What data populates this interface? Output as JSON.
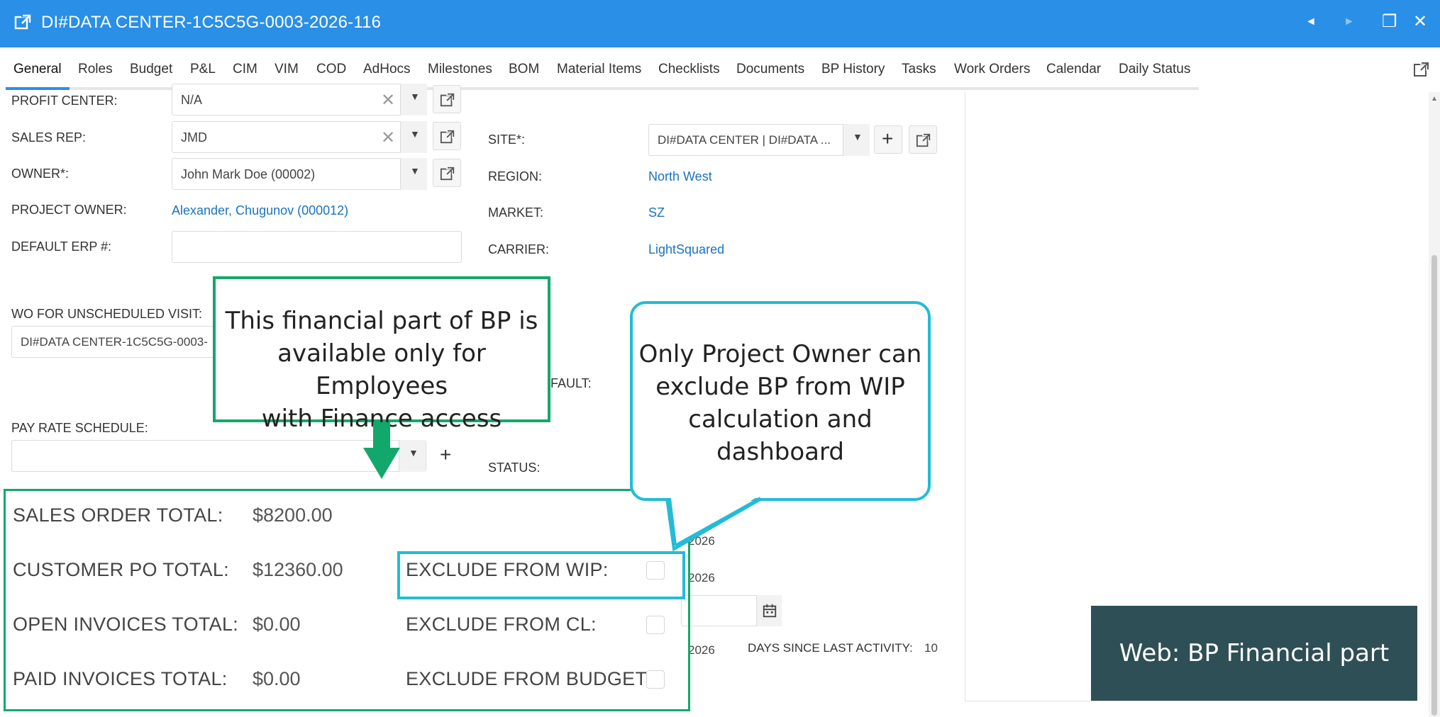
{
  "window": {
    "title": "DI#DATA CENTER-1C5C5G-0003-2026-116",
    "controls": [
      "◄",
      "►",
      "❐",
      "✕"
    ]
  },
  "tabs": [
    "General",
    "Roles",
    "Budget",
    "P&L",
    "CIM",
    "VIM",
    "COD",
    "AdHocs",
    "Milestones",
    "BOM",
    "Material Items",
    "Checklists",
    "Documents",
    "BP History",
    "Tasks",
    "Work Orders",
    "Calendar",
    "Daily Status"
  ],
  "active_tab": "General",
  "left_form": {
    "profit_center": {
      "label": "PROFIT CENTER:",
      "value": "N/A"
    },
    "sales_rep": {
      "label": "SALES REP:",
      "value": "JMD"
    },
    "owner": {
      "label": "OWNER*:",
      "value": "John Mark Doe (00002)"
    },
    "project_owner": {
      "label": "PROJECT OWNER:",
      "value": "Alexander, Chugunov (000012)"
    },
    "default_erp": {
      "label": "DEFAULT ERP #:",
      "value": ""
    },
    "wo_unscheduled": {
      "label": "WO FOR UNSCHEDULED VISIT:",
      "value": "DI#DATA CENTER-1C5C5G-0003-"
    },
    "pay_rate": {
      "label": "PAY RATE SCHEDULE:",
      "value": ""
    }
  },
  "right_form": {
    "site": {
      "label": "SITE*:",
      "value": "DI#DATA CENTER | DI#DATA ..."
    },
    "region": {
      "label": "REGION:",
      "value": "North West"
    },
    "market": {
      "label": "MARKET:",
      "value": "SZ"
    },
    "carrier": {
      "label": "CARRIER:",
      "value": "LightSquared"
    },
    "default_partial": "FAULT:",
    "status": {
      "label": "STATUS:"
    },
    "date1": "2026",
    "date2": "2026",
    "date3": "2026",
    "days_since": {
      "label": "DAYS SINCE LAST ACTIVITY:",
      "value": "10"
    }
  },
  "financial": {
    "sales_order_total": {
      "label": "SALES ORDER TOTAL:",
      "value": "$8200.00"
    },
    "customer_po_total": {
      "label": "CUSTOMER PO TOTAL:",
      "value": "$12360.00"
    },
    "open_invoices_total": {
      "label": "OPEN INVOICES TOTAL:",
      "value": "$0.00"
    },
    "paid_invoices_total": {
      "label": "PAID INVOICES TOTAL:",
      "value": "$0.00"
    },
    "exclude_wip": {
      "label": "EXCLUDE FROM WIP:",
      "checked": false
    },
    "exclude_cl": {
      "label": "EXCLUDE FROM CL:",
      "checked": false
    },
    "exclude_budget": {
      "label": "EXCLUDE FROM BUDGET:",
      "checked": false
    }
  },
  "callouts": {
    "finance_line1": "This financial part of BP is",
    "finance_line2": "available only for Employees",
    "finance_line3": "with Finance access",
    "wip_line1": "Only Project Owner can",
    "wip_line2": "exclude BP from WIP",
    "wip_line3": "calculation and",
    "wip_line4": "dashboard"
  },
  "badge": "Web: BP Financial part",
  "colors": {
    "titlebar": "#2a8fe6",
    "link": "#1a73c0",
    "green": "#13a86b",
    "cyan": "#22bcd6",
    "badge": "#2e4f55"
  }
}
